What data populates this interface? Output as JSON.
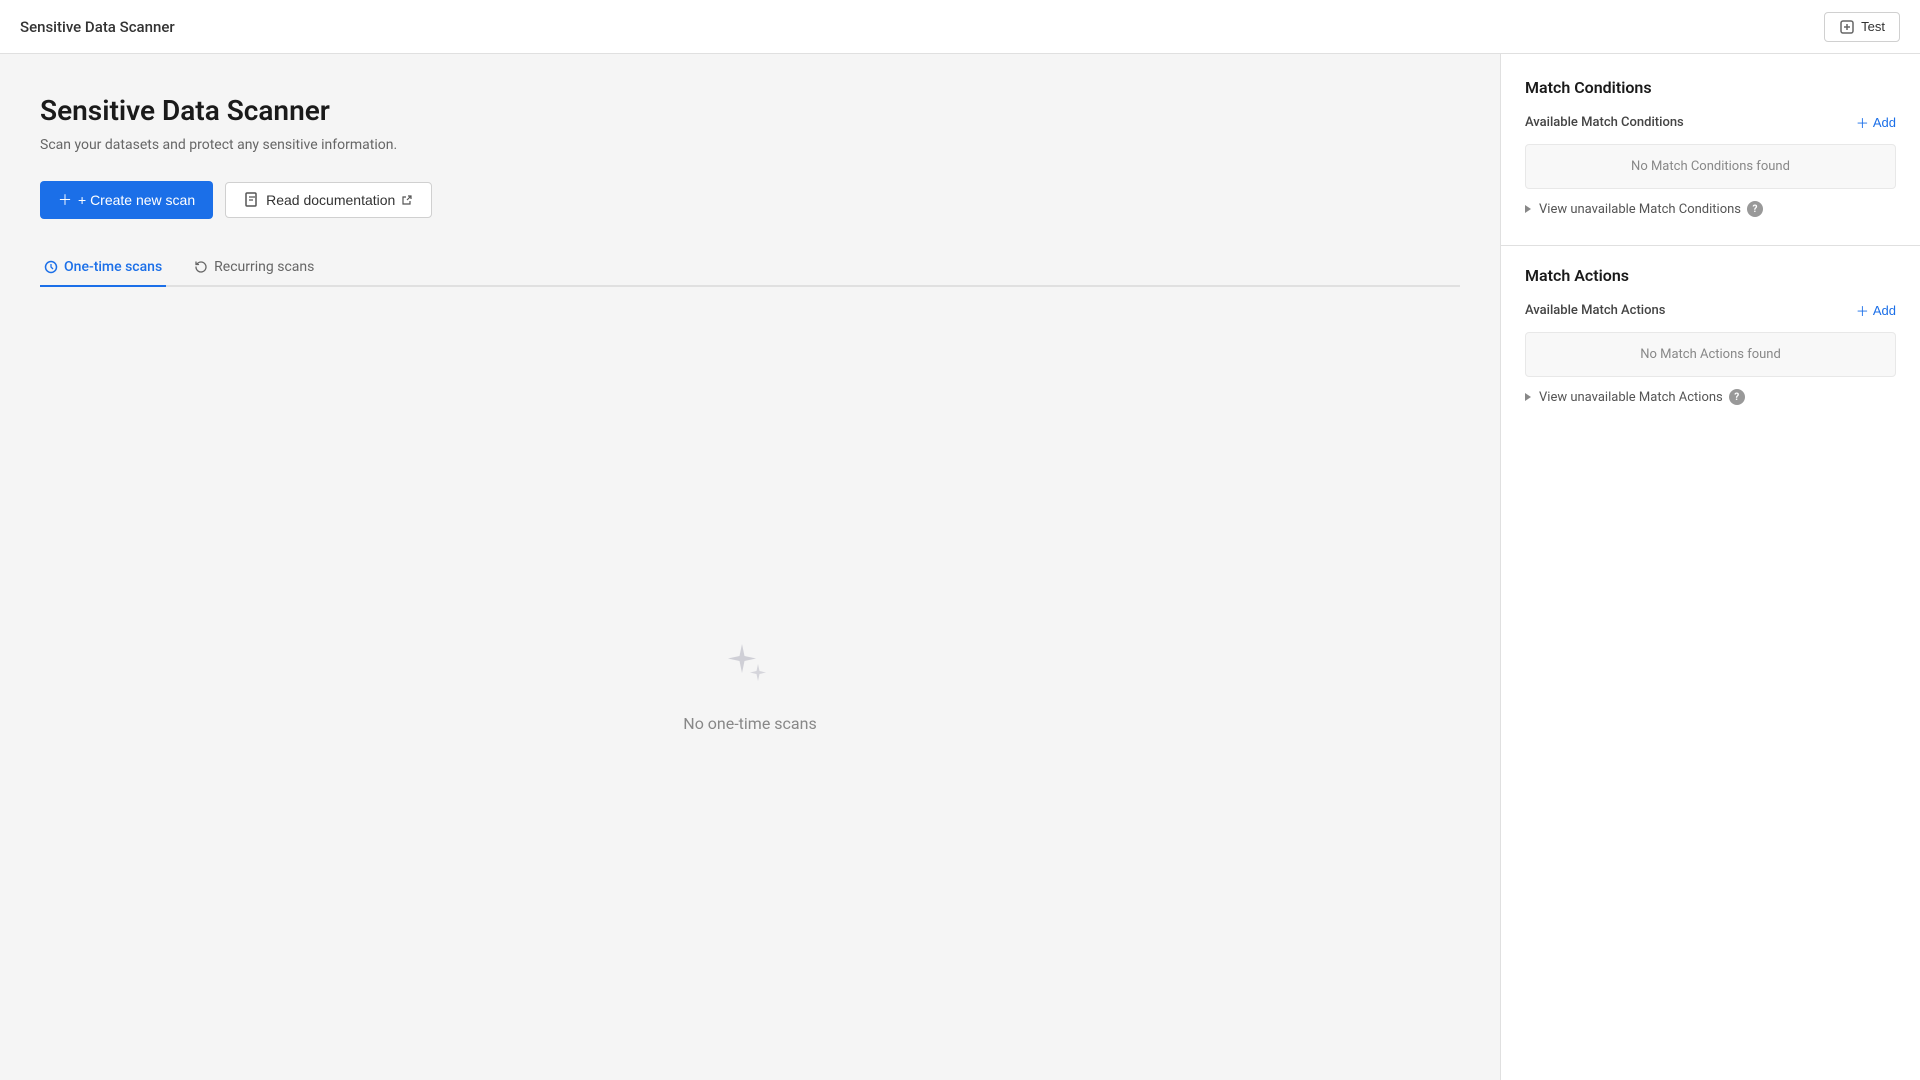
{
  "topNav": {
    "title": "Sensitive Data Scanner",
    "testButton": "Test"
  },
  "page": {
    "title": "Sensitive Data Scanner",
    "subtitle": "Scan your datasets and protect any sensitive information.",
    "createNewScanLabel": "+ Create new scan",
    "readDocLabel": "Read documentation"
  },
  "tabs": [
    {
      "id": "one-time",
      "label": "One-time scans",
      "active": true
    },
    {
      "id": "recurring",
      "label": "Recurring scans",
      "active": false
    }
  ],
  "emptyState": {
    "text": "No one-time scans"
  },
  "sidebar": {
    "matchConditions": {
      "sectionTitle": "Match Conditions",
      "subLabel": "Available Match Conditions",
      "addLabel": "+ Add",
      "noItemsText": "No Match Conditions found",
      "viewUnavailable": "View unavailable Match Conditions"
    },
    "matchActions": {
      "sectionTitle": "Match Actions",
      "subLabel": "Available Match Actions",
      "addLabel": "+ Add",
      "noItemsText": "No Match Actions found",
      "viewUnavailable": "View unavailable Match Actions"
    }
  }
}
